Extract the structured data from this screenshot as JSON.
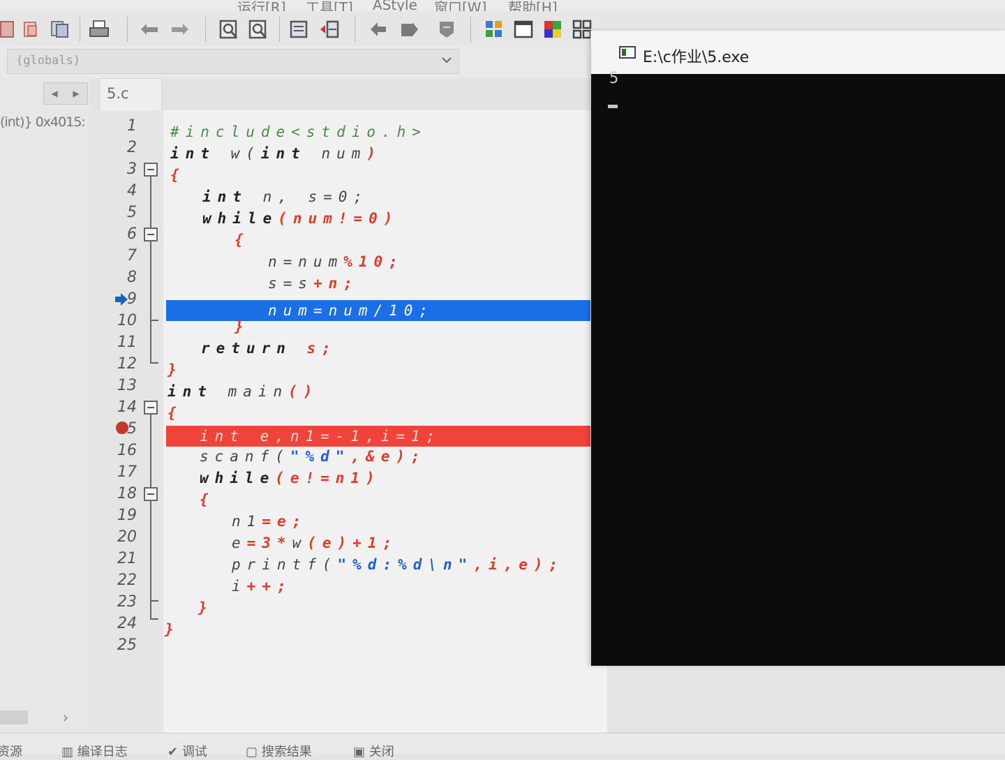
{
  "menu": [
    "运行[R]",
    "工具[T]",
    "AStyle",
    "窗口[W]",
    "帮助[H]"
  ],
  "globals": {
    "selected": "(globals)"
  },
  "left_panel": {
    "debug_value": "(int)} 0x4015:"
  },
  "editor": {
    "tab": "5.c",
    "lines": [
      {
        "num": "1"
      },
      {
        "num": "2"
      },
      {
        "num": "3"
      },
      {
        "num": "4"
      },
      {
        "num": "5"
      },
      {
        "num": "6"
      },
      {
        "num": "7"
      },
      {
        "num": "8"
      },
      {
        "num": "9"
      },
      {
        "num": "10"
      },
      {
        "num": "11"
      },
      {
        "num": "12"
      },
      {
        "num": "13"
      },
      {
        "num": "14"
      },
      {
        "num": "15"
      },
      {
        "num": "16"
      },
      {
        "num": "17"
      },
      {
        "num": "18"
      },
      {
        "num": "19"
      },
      {
        "num": "20"
      },
      {
        "num": "21"
      },
      {
        "num": "22"
      },
      {
        "num": "23"
      },
      {
        "num": "24"
      },
      {
        "num": "25"
      }
    ],
    "code": {
      "l1": "#include<stdio.h>",
      "l2a": "int",
      "l2b": " w(",
      "l2c": "int",
      "l2d": " num",
      "l2e": ")",
      "l3": "{",
      "l4a": "int",
      "l4b": " n, s=0;",
      "l5a": "while",
      "l5b": "(num!=0)",
      "l6": "{",
      "l7a": "n=num",
      "l7b": "%10;",
      "l8a": "s=s",
      "l8b": "+n;",
      "l9": "num=num/10;",
      "l10": "}",
      "l11a": "return",
      "l11b": " s;",
      "l12": "}",
      "l13a": "int",
      "l13b": " main",
      "l13c": "()",
      "l14": "{",
      "l15": "int e,n1=-1,i=1;",
      "l16a": "scanf(",
      "l16b": "\"%d\"",
      "l16c": ",&e);",
      "l17a": "while",
      "l17b": "(e!=n1)",
      "l18": "{",
      "l19a": "n1",
      "l19b": "=e;",
      "l20a": "e",
      "l20b": "=3*",
      "l20c": "w",
      "l20d": "(e)+1;",
      "l21a": "printf(",
      "l21b": "\"%d:%d\\n\"",
      "l21c": ",i,e);",
      "l22a": "i",
      "l22b": "++;",
      "l23": "}",
      "l24": "}"
    }
  },
  "console": {
    "title": "E:\\c作业\\5.exe",
    "output": "5"
  },
  "bottom_tabs": [
    "资源",
    "编译日志",
    "调试",
    "搜索结果",
    "关闭"
  ],
  "colors": {
    "current_line": "#1a6fe6",
    "breakpoint_line": "#f0433a",
    "console_bg": "#0c0c0c"
  }
}
